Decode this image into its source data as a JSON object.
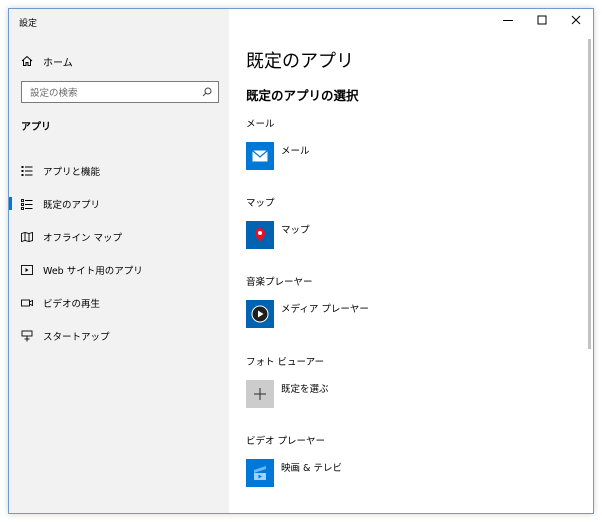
{
  "window": {
    "title": "設定"
  },
  "sidebar": {
    "home_label": "ホーム",
    "search_placeholder": "設定の検索",
    "section_label": "アプリ",
    "items": [
      {
        "label": "アプリと機能",
        "icon": "list-icon"
      },
      {
        "label": "既定のアプリ",
        "icon": "default-apps-icon",
        "selected": true
      },
      {
        "label": "オフライン マップ",
        "icon": "map-icon"
      },
      {
        "label": "Web サイト用のアプリ",
        "icon": "web-app-icon"
      },
      {
        "label": "ビデオの再生",
        "icon": "video-icon"
      },
      {
        "label": "スタートアップ",
        "icon": "startup-icon"
      }
    ]
  },
  "main": {
    "page_title": "既定のアプリ",
    "section_title": "既定のアプリの選択",
    "categories": [
      {
        "label": "メール",
        "app": "メール",
        "icon": "mail-app-icon",
        "color": "#0078d7"
      },
      {
        "label": "マップ",
        "app": "マップ",
        "icon": "maps-app-icon",
        "color": "#0063b1"
      },
      {
        "label": "音楽プレーヤー",
        "app": "メディア プレーヤー",
        "icon": "media-player-icon",
        "color": "#0063b1"
      },
      {
        "label": "フォト ビューアー",
        "app": "既定を選ぶ",
        "icon": "plus-icon",
        "color": "#cccccc"
      },
      {
        "label": "ビデオ プレーヤー",
        "app": "映画 & テレビ",
        "icon": "movies-tv-icon",
        "color": "#0078d7"
      }
    ]
  },
  "colors": {
    "accent": "#0078d7",
    "sidebar_bg": "#f2f2f2"
  }
}
